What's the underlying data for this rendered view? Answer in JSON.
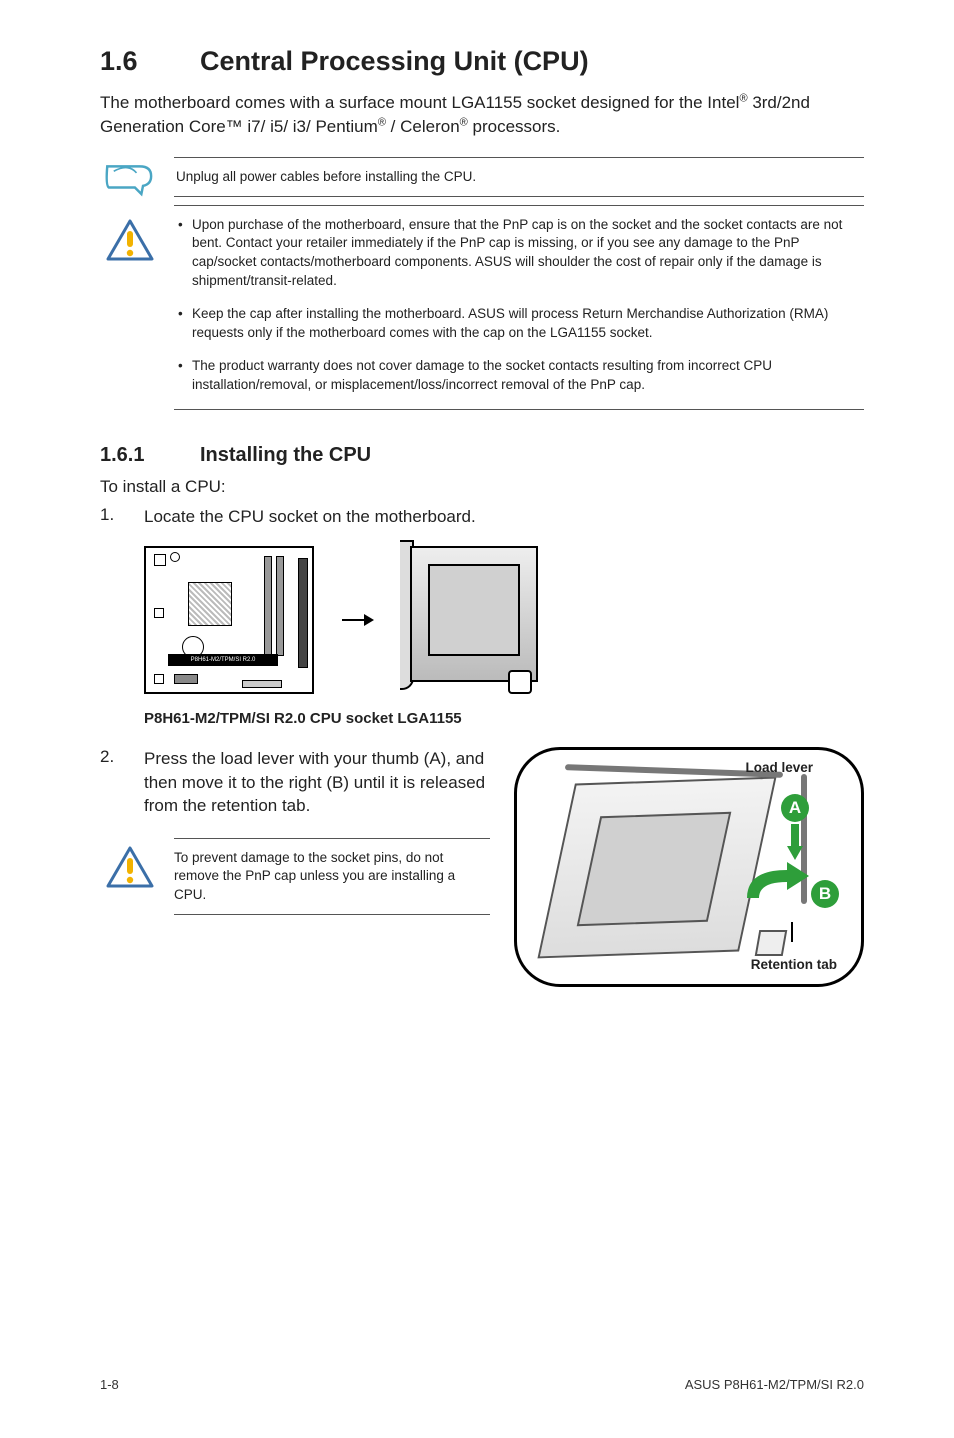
{
  "section": {
    "number": "1.6",
    "title": "Central Processing Unit (CPU)"
  },
  "intro": {
    "line1a": "The motherboard comes with a surface mount LGA1155 socket designed for the Intel",
    "line1sup": "®",
    "line2a": "3rd/2nd Generation Core™ i7/ i5/ i3/ Pentium",
    "line2sup1": "®",
    "line2b": " / Celeron",
    "line2sup2": "®",
    "line2c": " processors."
  },
  "note_unplug": "Unplug all power cables before installing the CPU.",
  "caution_bullets": [
    "Upon purchase of the motherboard, ensure that the PnP cap is on the socket and the socket contacts are not bent. Contact your retailer immediately if the PnP cap is missing, or if you see any damage to the PnP cap/socket contacts/motherboard components. ASUS will shoulder the cost of repair only if the damage is shipment/transit-related.",
    "Keep the cap after installing the motherboard. ASUS will process Return Merchandise Authorization (RMA) requests only if the motherboard comes with the cap on the LGA1155 socket.",
    "The product warranty does not cover damage to the socket contacts resulting from incorrect CPU installation/removal, or misplacement/loss/incorrect removal of the PnP cap."
  ],
  "subsection": {
    "number": "1.6.1",
    "title": "Installing the CPU"
  },
  "install_intro": "To install a CPU:",
  "step1_text": "Locate the CPU socket on the motherboard.",
  "board_label": "P8H61-M2/TPM/SI R2.0",
  "diag_caption": "P8H61-M2/TPM/SI R2.0 CPU socket LGA1155",
  "step2_text": "Press the load lever with your thumb (A), and then move it to the right (B) until it is released from the retention tab.",
  "inner_caution": "To prevent damage to the socket pins, do not remove the PnP cap unless you are installing a CPU.",
  "diagram_labels": {
    "load_lever": "Load lever",
    "retention_tab": "Retention tab",
    "A": "A",
    "B": "B"
  },
  "footer": {
    "left": "1-8",
    "right": "ASUS P8H61-M2/TPM/SI R2.0"
  }
}
